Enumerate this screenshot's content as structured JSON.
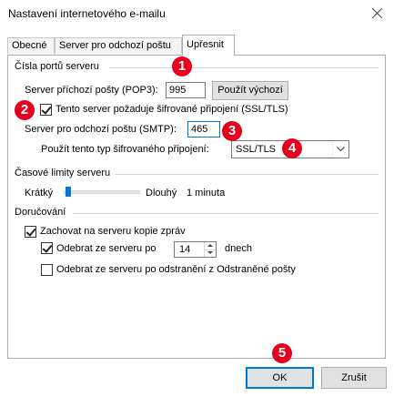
{
  "window": {
    "title": "Nastavení internetového e-mailu"
  },
  "tabs": [
    {
      "label": "Obecné"
    },
    {
      "label": "Server pro odchozí poštu"
    },
    {
      "label": "Upřesnit"
    }
  ],
  "ports": {
    "group_label": "Čísla portů serveru",
    "incoming_label": "Server příchozí pošty (POP3):",
    "incoming_value": "995",
    "default_button": "Použít výchozí",
    "ssl_checkbox_label": "Tento server požaduje šifrované připojení (SSL/TLS)",
    "ssl_checked": true,
    "outgoing_label": "Server pro odchozí poštu (SMTP):",
    "outgoing_value": "465",
    "encryption_label": "Použít tento typ šifrovaného připojení:",
    "encryption_value": "SSL/TLS"
  },
  "timeouts": {
    "group_label": "Časové limity serveru",
    "short_label": "Krátký",
    "long_label": "Dlouhý",
    "value_label": "1 minuta"
  },
  "delivery": {
    "group_label": "Doručování",
    "keep_copy_label": "Zachovat na serveru kopie zpráv",
    "keep_copy_checked": true,
    "remove_after_label": "Odebrat ze serveru po",
    "remove_after_checked": true,
    "remove_after_value": "14",
    "days_label": "dnech",
    "remove_deleted_label": "Odebrat ze serveru po odstranění z Odstraněné pošty",
    "remove_deleted_checked": false
  },
  "buttons": {
    "ok": "OK",
    "cancel": "Zrušit"
  },
  "markers": [
    "1",
    "2",
    "3",
    "4",
    "5"
  ],
  "colors": {
    "marker": "#e6001f",
    "accent": "#0078d7"
  }
}
